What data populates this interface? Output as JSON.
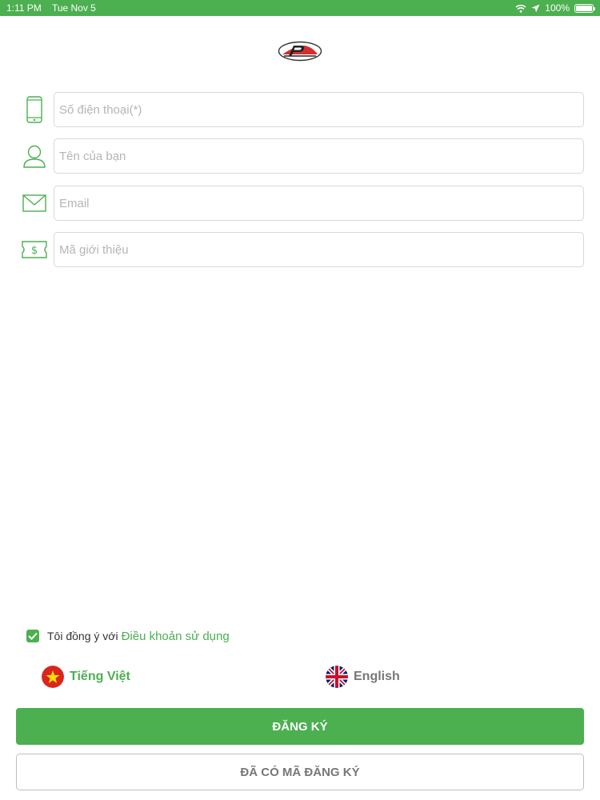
{
  "status_bar": {
    "time": "1:11 PM",
    "date": "Tue Nov 5",
    "battery": "100%",
    "battery_level": 1.0,
    "icons": [
      "wifi-icon",
      "location-icon",
      "battery-icon"
    ]
  },
  "colors": {
    "accent": "#4caf50",
    "input_border": "#d8d8d8",
    "placeholder": "#b5b5b5",
    "secondary_text": "#777777"
  },
  "form": {
    "phone": {
      "placeholder": "Số điện thoại(*)",
      "value": "",
      "icon": "phone-icon"
    },
    "name": {
      "placeholder": "Tên của bạn",
      "value": "",
      "icon": "user-icon"
    },
    "email": {
      "placeholder": "Email",
      "value": "",
      "icon": "mail-icon"
    },
    "referral": {
      "placeholder": "Mã giới thiệu",
      "value": "",
      "icon": "ticket-icon"
    }
  },
  "terms": {
    "checked": true,
    "text": "Tôi đồng ý với",
    "link": "Điều khoản sử dụng"
  },
  "languages": {
    "vietnamese": "Tiếng Việt",
    "english": "English",
    "selected": "Tiếng Việt"
  },
  "buttons": {
    "register": "ĐĂNG KÝ",
    "have_code": "ĐÃ CÓ MÃ ĐĂNG KÝ"
  }
}
